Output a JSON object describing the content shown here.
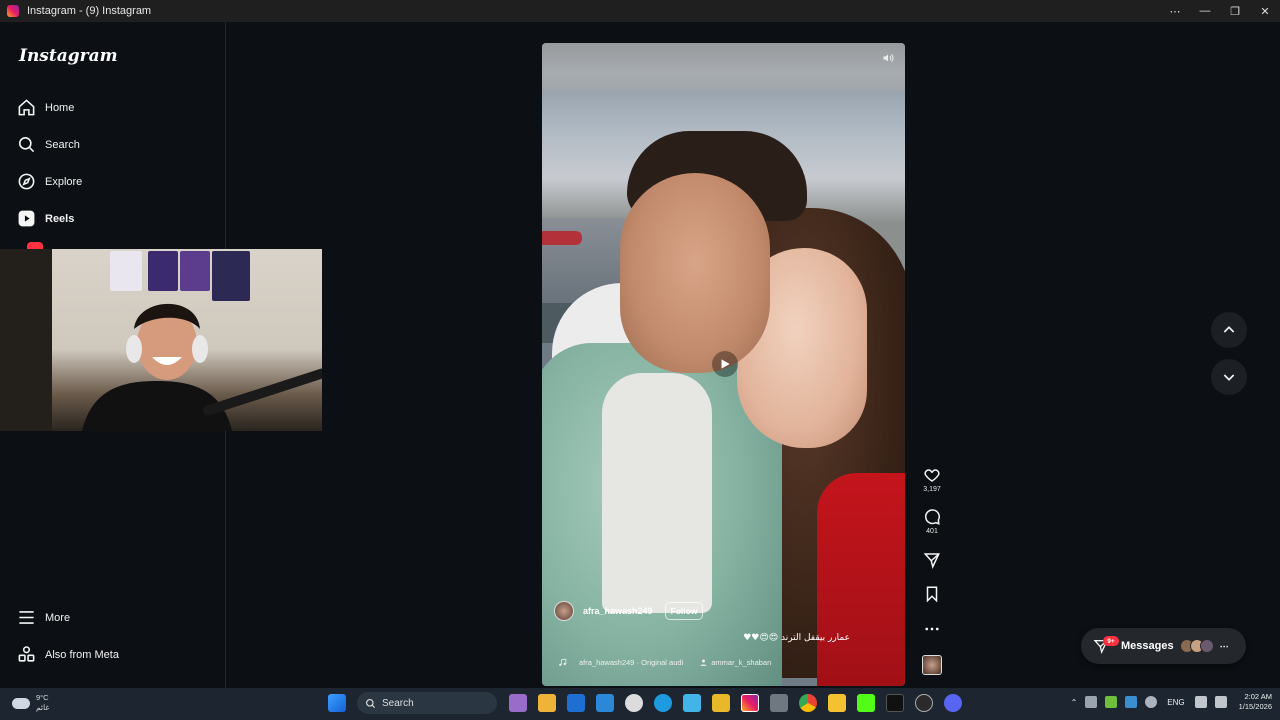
{
  "window": {
    "title": "Instagram - (9) Instagram",
    "controls": [
      "⋯",
      "—",
      "❐",
      "✕"
    ]
  },
  "sidebar": {
    "logo": "Instagram",
    "items": [
      {
        "label": "Home",
        "icon": "home-icon"
      },
      {
        "label": "Search",
        "icon": "search-icon"
      },
      {
        "label": "Explore",
        "icon": "compass-icon"
      },
      {
        "label": "Reels",
        "icon": "reels-icon",
        "active": true
      }
    ],
    "bottom": [
      {
        "label": "More",
        "icon": "menu-icon"
      },
      {
        "label": "Also from Meta",
        "icon": "meta-apps-icon"
      }
    ]
  },
  "reel": {
    "username": "afra_hawash249",
    "follow_label": "Follow",
    "caption": "عمارر بيقفل الترند 😍😍♥♥",
    "audio": "afra_hawash249 · Original audi",
    "tagged_user": "ammar_k_shaban",
    "likes": "3,197",
    "comments": "401"
  },
  "messages": {
    "label": "Messages",
    "badge": "9+"
  },
  "taskbar": {
    "weather_temp": "9°C",
    "weather_text": "غائم",
    "search_label": "Search",
    "language": "ENG",
    "time": "2:02 AM",
    "date": "1/15/2026"
  },
  "colors": {
    "background": "#0c1014",
    "badge": "#ff3040",
    "taskbar": "#1c2530"
  }
}
